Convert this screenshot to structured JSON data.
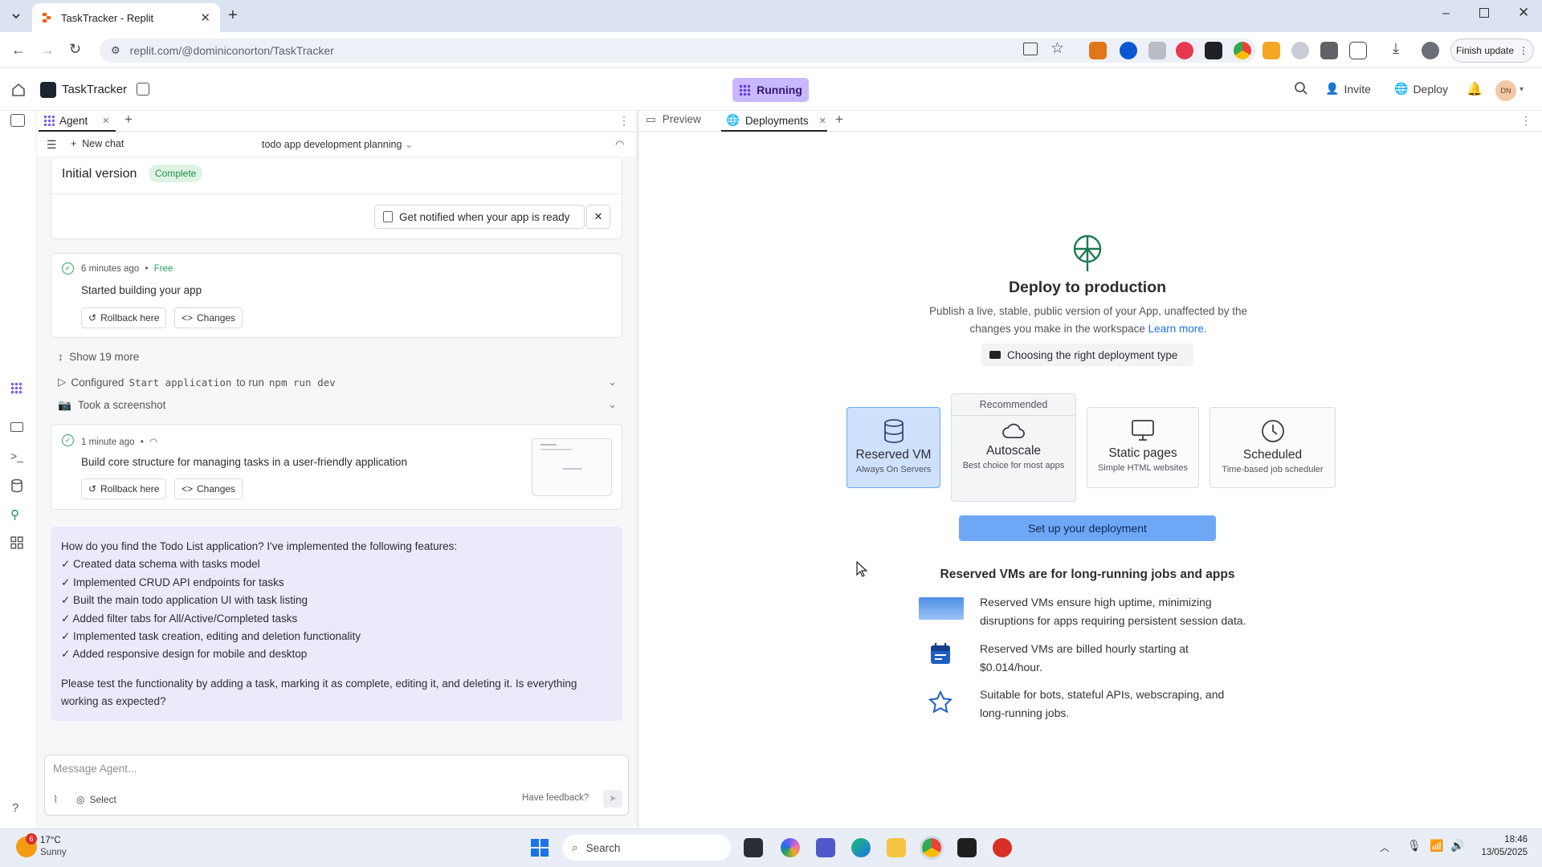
{
  "browser": {
    "tab_title": "TaskTracker - Replit",
    "url": "replit.com/@dominiconorton/TaskTracker",
    "finish_update": "Finish update"
  },
  "app": {
    "name": "TaskTracker",
    "running_label": "Running",
    "invite_label": "Invite",
    "deploy_label": "Deploy",
    "avatar_initials": "DN"
  },
  "agent": {
    "tab_label": "Agent",
    "new_chat": "New chat",
    "chat_title": "todo app development planning",
    "initial_version": "Initial version",
    "complete_badge": "Complete",
    "notify_label": "Get notified when your app is ready",
    "checkpoint1": {
      "time": "6 minutes ago",
      "separator": "•",
      "tier": "Free",
      "text": "Started building your app",
      "rollback": "Rollback here",
      "changes": "Changes"
    },
    "show_more": "Show 19 more",
    "configured_prefix": "Configured",
    "configured_code": "Start application",
    "configured_middle": "to run",
    "configured_cmd": "npm run dev",
    "screenshot_label": "Took a screenshot",
    "checkpoint2": {
      "time": "1 minute ago",
      "separator": "•",
      "text": "Build core structure for managing tasks in a user-friendly application",
      "rollback": "Rollback here",
      "changes": "Changes"
    },
    "message_intro": "How do you find the Todo List application? I've implemented the following features:",
    "features": [
      "✓ Created data schema with tasks model",
      "✓ Implemented CRUD API endpoints for tasks",
      "✓ Built the main todo application UI with task listing",
      "✓ Added filter tabs for All/Active/Completed tasks",
      "✓ Implemented task creation, editing and deletion functionality",
      "✓ Added responsive design for mobile and desktop"
    ],
    "message_outro": "Please test the functionality by adding a task, marking it as complete, editing it, and deleting it. Is everything working as expected?",
    "input_placeholder": "Message Agent...",
    "select_label": "Select",
    "feedback_label": "Have feedback?"
  },
  "right": {
    "tabs": [
      "Preview",
      "Deployments"
    ],
    "heading": "Deploy to production",
    "description": "Publish a live, stable, public version of your App, unaffected by the changes you make in the workspace",
    "learn_more": "Learn more.",
    "video_link": "Choosing the right deployment type",
    "recommended": "Recommended",
    "options": [
      {
        "title": "Reserved VM",
        "subtitle": "Always On Servers"
      },
      {
        "title": "Autoscale",
        "subtitle": "Best choice for most apps"
      },
      {
        "title": "Static pages",
        "subtitle": "Simple HTML websites"
      },
      {
        "title": "Scheduled",
        "subtitle": "Time-based job scheduler"
      }
    ],
    "cta": "Set up your deployment",
    "info_heading": "Reserved VMs are for long-running jobs and apps",
    "bullets": [
      "Reserved VMs ensure high uptime, minimizing disruptions for apps requiring persistent session data.",
      "Reserved VMs are billed hourly starting at $0.014/hour.",
      "Suitable for bots, stateful APIs, webscraping, and long-running jobs."
    ]
  },
  "taskbar": {
    "temperature": "17°C",
    "weather": "Sunny",
    "weather_badge": "6",
    "search": "Search",
    "time": "18:46",
    "date": "13/05/2025"
  },
  "colors": {
    "accent_blue": "#6ea7f5",
    "running_purple": "#c9b7ff",
    "selected_option": "#cfe0fb",
    "complete_green": "#29a35a"
  }
}
